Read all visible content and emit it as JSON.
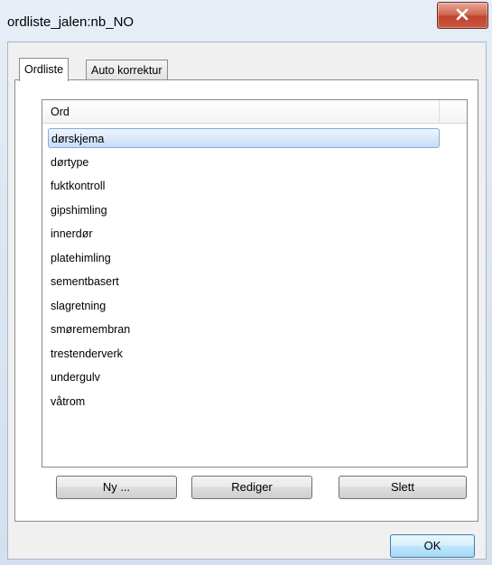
{
  "window": {
    "title": "ordliste_jalen:nb_NO"
  },
  "tabs": [
    {
      "label": "Ordliste",
      "active": true
    },
    {
      "label": "Auto korrektur",
      "active": false
    }
  ],
  "list": {
    "column_header": "Ord",
    "items": [
      "dørskjema",
      "dørtype",
      "fuktkontroll",
      "gipshimling",
      "innerdør",
      "platehimling",
      "sementbasert",
      "slagretning",
      "smøremembran",
      "trestenderverk",
      "undergulv",
      "våtrom"
    ],
    "selected_index": 0
  },
  "buttons": {
    "new": "Ny ...",
    "edit": "Rediger",
    "delete": "Slett",
    "ok": "OK"
  },
  "icons": {
    "close": "close-x-icon"
  },
  "colors": {
    "close_button": "#c9573f",
    "selection": "#c8ddf6"
  }
}
